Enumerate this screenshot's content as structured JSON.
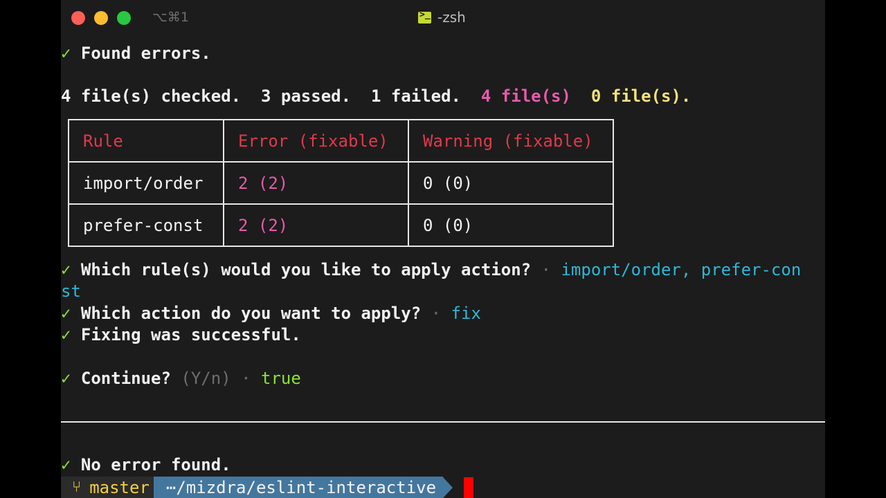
{
  "window": {
    "title": "-zsh",
    "shortcut": "⌥⌘1",
    "terminal_icon": "terminal-icon"
  },
  "output": {
    "check": "✓",
    "found_errors": "Found errors.",
    "summary": {
      "checked": "4 file(s) checked.",
      "passed": "3 passed.",
      "failed": "1 failed.",
      "pink_files": "4 file(s)",
      "yellow_files": "0 file(s)."
    },
    "table": {
      "headers": [
        "Rule",
        "Error (fixable)",
        "Warning (fixable)"
      ],
      "rows": [
        [
          "import/order",
          "2 (2)",
          "0 (0)"
        ],
        [
          "prefer-const",
          "2 (2)",
          "0 (0)"
        ]
      ]
    },
    "q1": "Which rule(s) would you like to apply action?",
    "q1_answer_line1": "import/order, prefer-con",
    "q1_answer_line2": "st",
    "q2": "Which action do you want to apply?",
    "q2_answer": "fix",
    "fix_success": "Fixing was successful.",
    "q3": "Continue?",
    "q3_hint": "(Y/n)",
    "q3_answer": "true",
    "sep_dot": "·",
    "no_error": "No error found."
  },
  "prompt": {
    "branch_icon": "git-branch-icon",
    "branch": "master",
    "path": "⋯/mizdra/eslint-interactive"
  },
  "colors": {
    "check": "#8ae234",
    "header_red": "#e0394b",
    "pink": "#e85aad",
    "yellow": "#f4e27a",
    "cyan": "#2fb7d6",
    "path_bg": "#44779e",
    "cursor": "#ff0000"
  }
}
